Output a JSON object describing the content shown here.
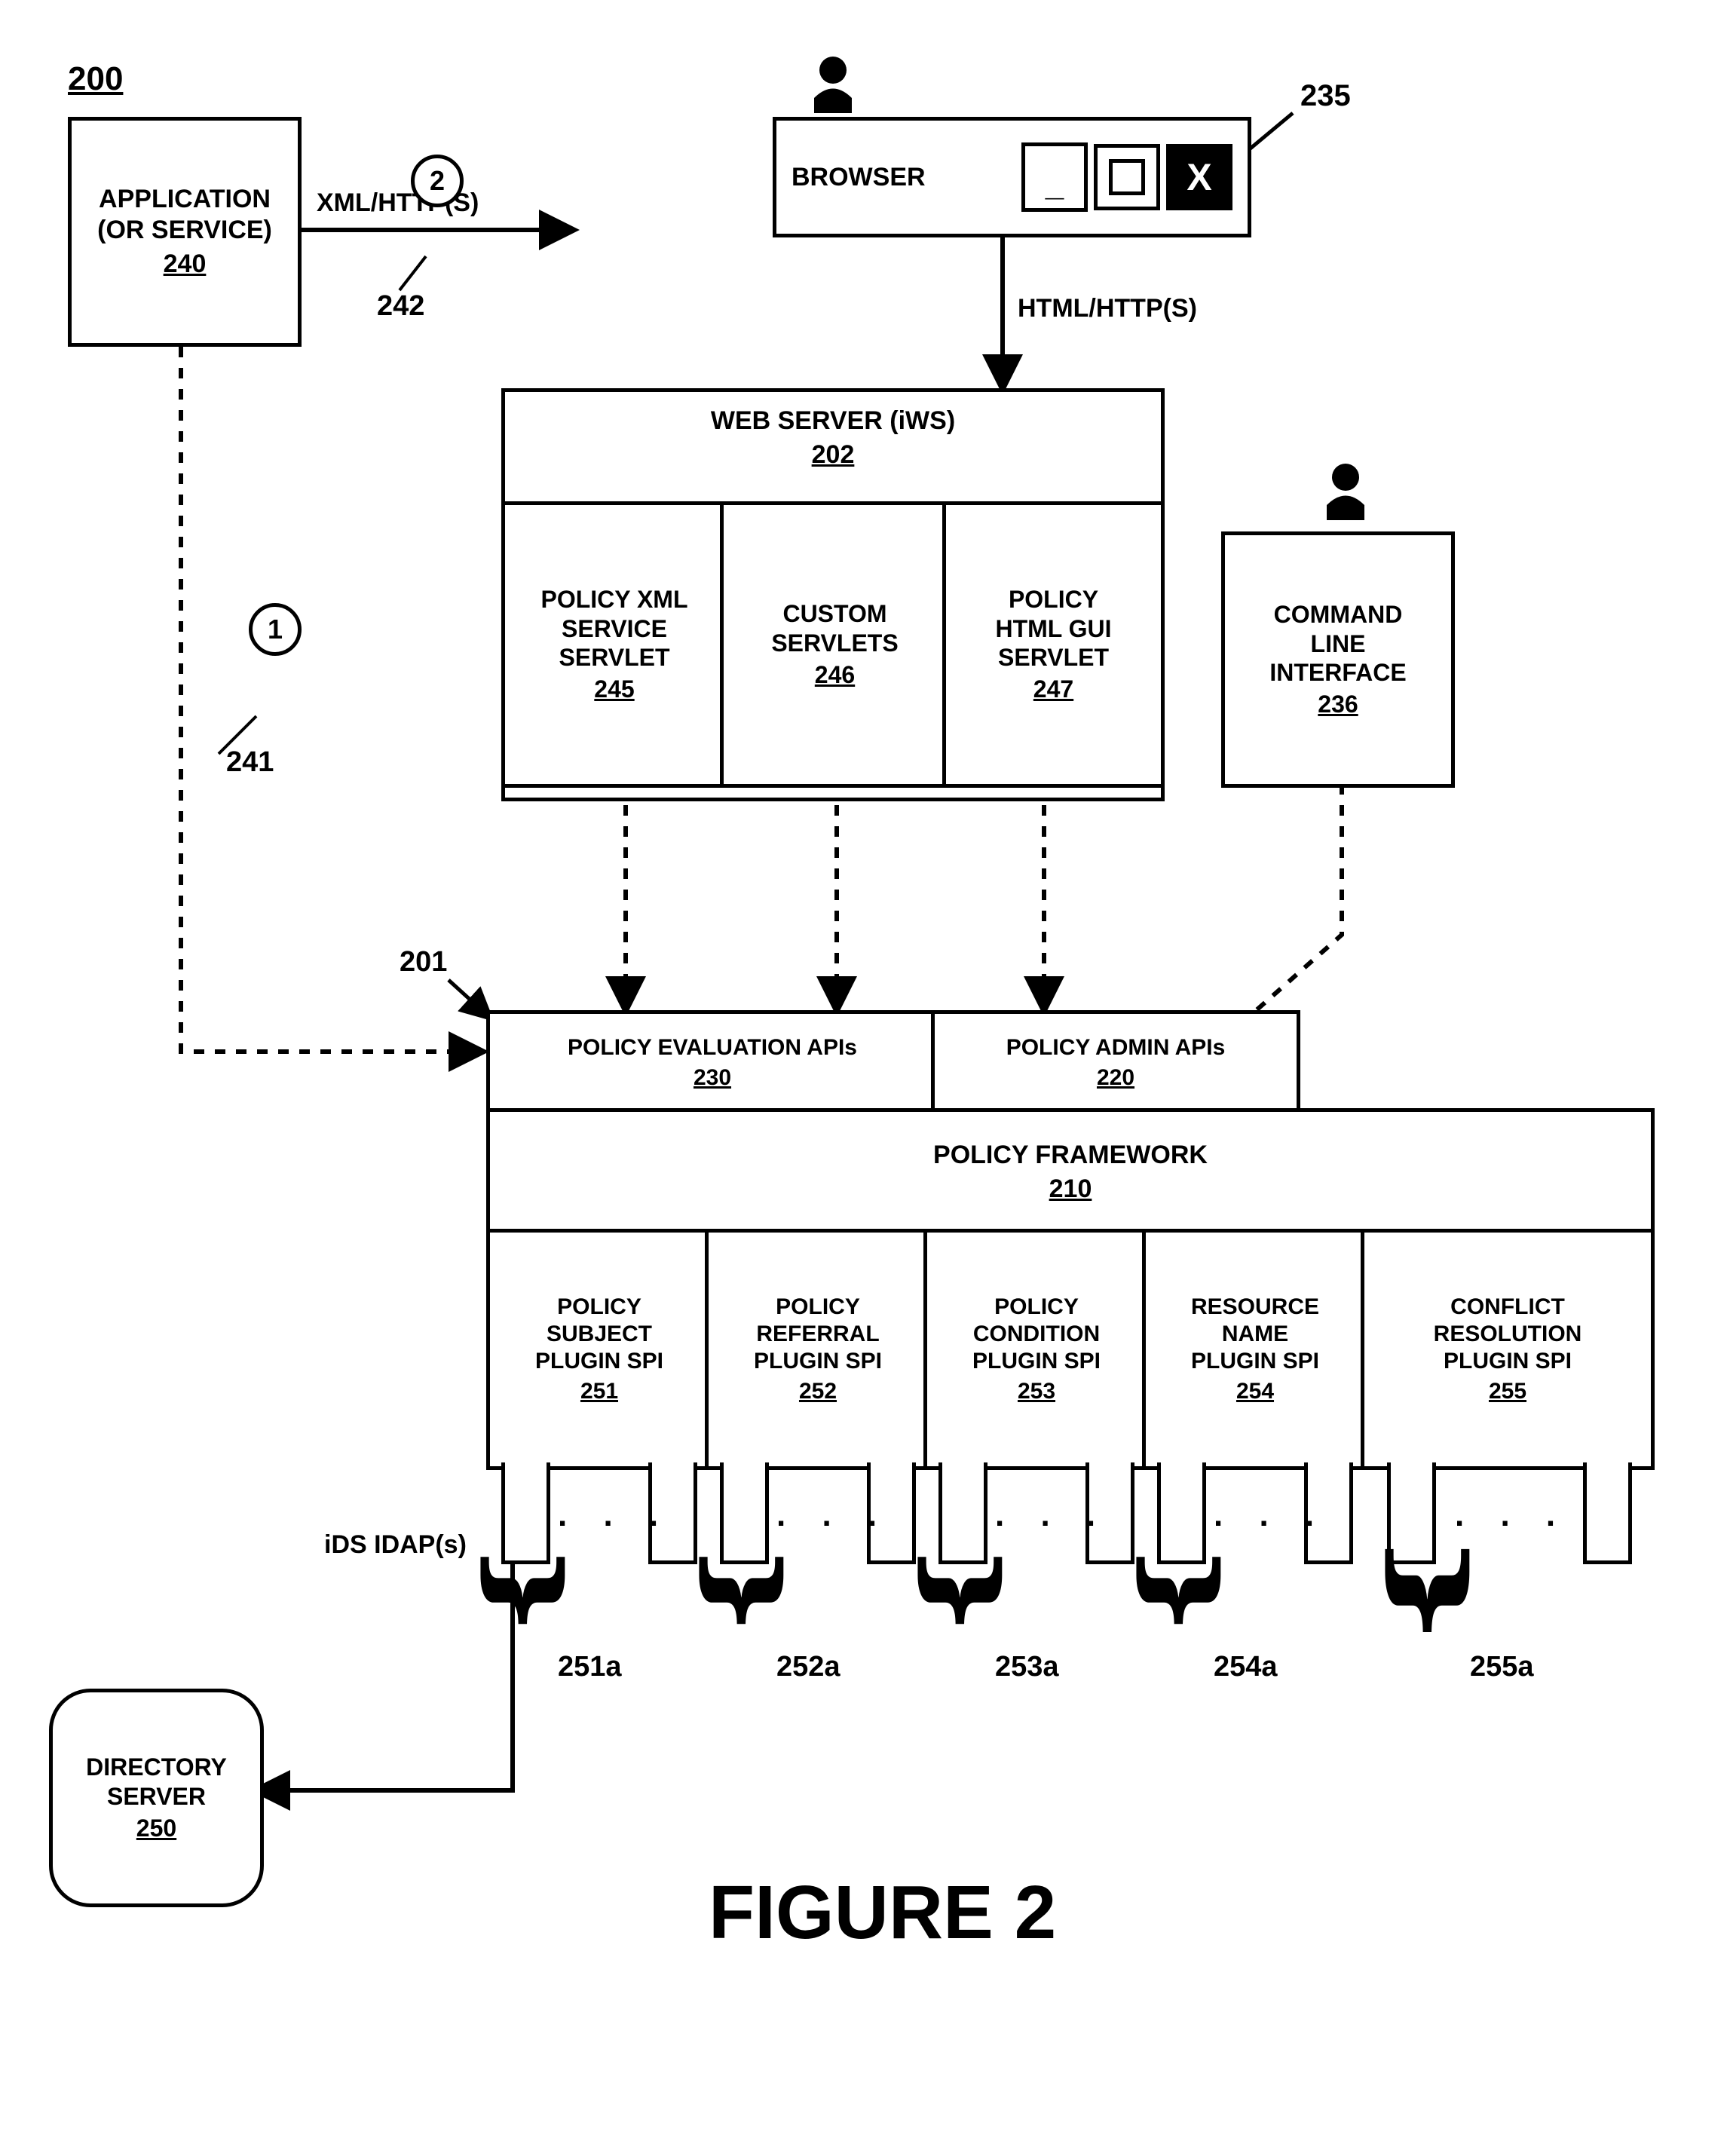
{
  "title_ref": "200",
  "figure": "FIGURE 2",
  "application": {
    "l1": "APPLICATION",
    "l2": "(OR SERVICE)",
    "ref": "240"
  },
  "browser": {
    "label": "BROWSER",
    "ref": "235",
    "minimize": "_",
    "close": "X"
  },
  "webserver": {
    "label": "WEB SERVER (iWS)",
    "ref": "202"
  },
  "servlets": {
    "xml": {
      "l1": "POLICY XML",
      "l2": "SERVICE",
      "l3": "SERVLET",
      "ref": "245"
    },
    "custom": {
      "l1": "CUSTOM",
      "l2": "SERVLETS",
      "ref": "246"
    },
    "html": {
      "l1": "POLICY",
      "l2": "HTML GUI",
      "l3": "SERVLET",
      "ref": "247"
    }
  },
  "cli": {
    "l1": "COMMAND",
    "l2": "LINE",
    "l3": "INTERFACE",
    "ref": "236"
  },
  "apis": {
    "container_ref": "201",
    "eval": {
      "label": "POLICY EVALUATION APIs",
      "ref": "230"
    },
    "admin": {
      "label": "POLICY ADMIN APIs",
      "ref": "220"
    }
  },
  "framework": {
    "label": "POLICY FRAMEWORK",
    "ref": "210"
  },
  "spis": {
    "subject": {
      "l1": "POLICY",
      "l2": "SUBJECT",
      "l3": "PLUGIN SPI",
      "ref": "251",
      "a": "251a"
    },
    "referral": {
      "l1": "POLICY",
      "l2": "REFERRAL",
      "l3": "PLUGIN SPI",
      "ref": "252",
      "a": "252a"
    },
    "condition": {
      "l1": "POLICY",
      "l2": "CONDITION",
      "l3": "PLUGIN SPI",
      "ref": "253",
      "a": "253a"
    },
    "resource": {
      "l1": "RESOURCE",
      "l2": "NAME",
      "l3": "PLUGIN SPI",
      "ref": "254",
      "a": "254a"
    },
    "conflict": {
      "l1": "CONFLICT",
      "l2": "RESOLUTION",
      "l3": "PLUGIN SPI",
      "ref": "255",
      "a": "255a"
    }
  },
  "directory": {
    "l1": "DIRECTORY",
    "l2": "SERVER",
    "ref": "250"
  },
  "edges": {
    "xml_http": "XML/HTTP(S)",
    "html_http": "HTML/HTTP(S)",
    "ids_ldap": "iDS  IDAP(s)",
    "n242": "242",
    "n241": "241",
    "n1": "1",
    "n2": "2"
  }
}
